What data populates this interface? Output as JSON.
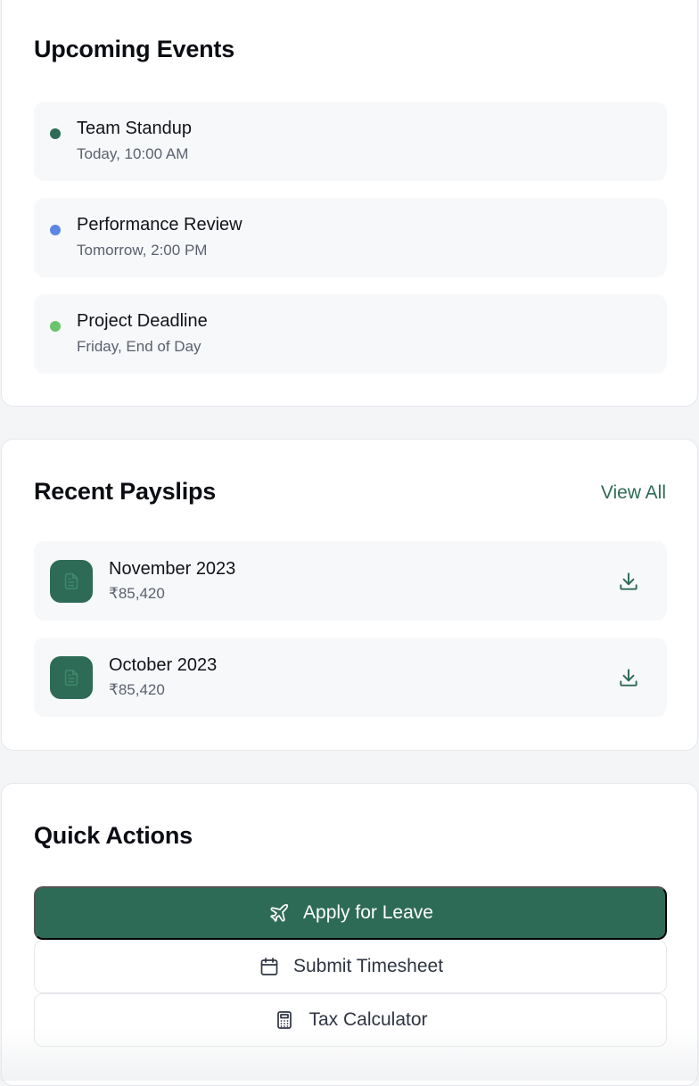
{
  "events": {
    "title": "Upcoming Events",
    "items": [
      {
        "title": "Team Standup",
        "time": "Today, 10:00 AM",
        "color": "#2e6b56"
      },
      {
        "title": "Performance Review",
        "time": "Tomorrow, 2:00 PM",
        "color": "#5b86e5"
      },
      {
        "title": "Project Deadline",
        "time": "Friday, End of Day",
        "color": "#6bc46d"
      }
    ]
  },
  "payslips": {
    "title": "Recent Payslips",
    "view_all": "View All",
    "items": [
      {
        "month": "November 2023",
        "amount": "₹85,420",
        "icon": "document-icon",
        "action_icon": "download-icon"
      },
      {
        "month": "October 2023",
        "amount": "₹85,420",
        "icon": "document-icon",
        "action_icon": "download-icon"
      }
    ]
  },
  "quick_actions": {
    "title": "Quick Actions",
    "buttons": [
      {
        "label": "Apply for Leave",
        "icon": "plane-icon",
        "style": "primary"
      },
      {
        "label": "Submit Timesheet",
        "icon": "calendar-icon",
        "style": "secondary"
      },
      {
        "label": "Tax Calculator",
        "icon": "calculator-icon",
        "style": "secondary"
      }
    ]
  },
  "colors": {
    "accent": "#2e6b56",
    "card_bg": "#ffffff",
    "item_bg": "#f7f8fa",
    "page_bg": "#f4f5f7"
  }
}
